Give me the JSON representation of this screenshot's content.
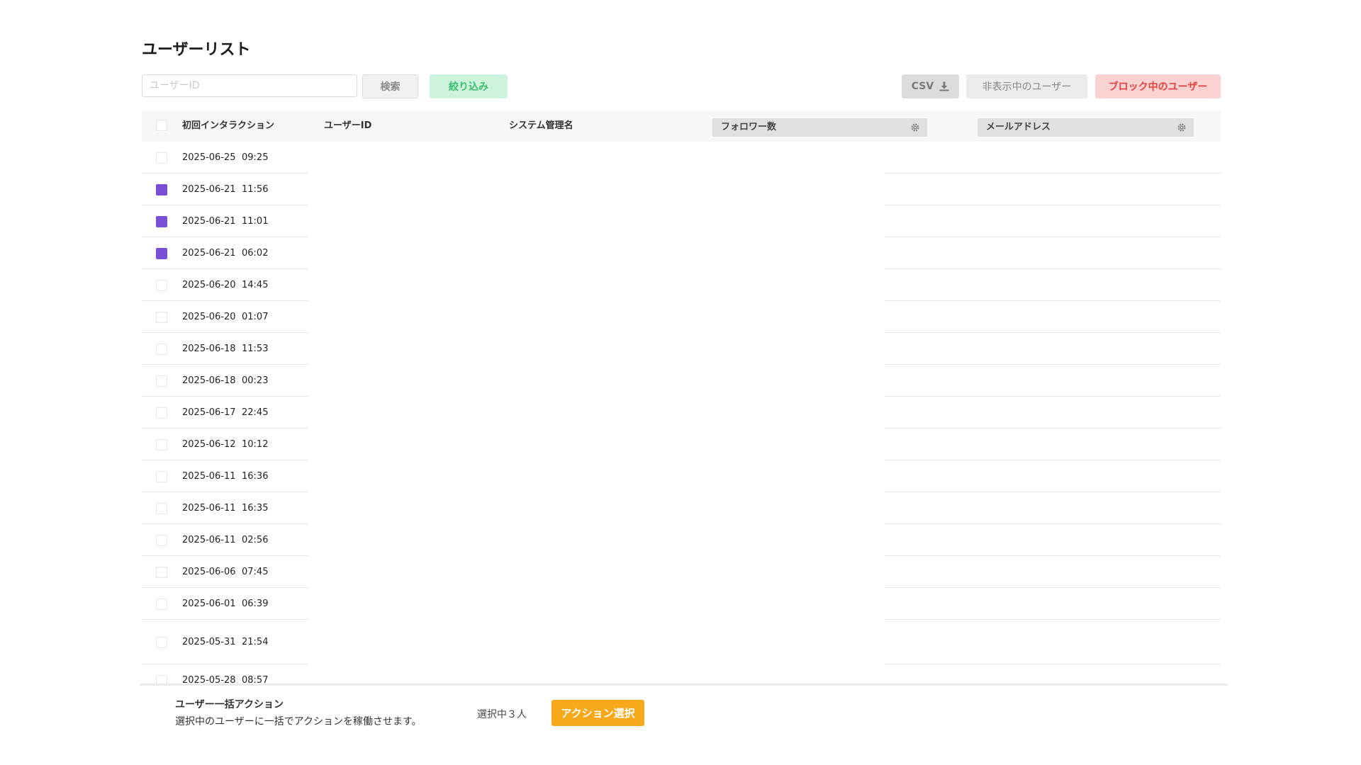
{
  "page": {
    "title": "ユーザーリスト"
  },
  "toolbar": {
    "search_placeholder": "ユーザーID",
    "search_value": "",
    "search_label": "検索",
    "filter_label": "絞り込み",
    "csv_label": "CSV",
    "hidden_users_label": "非表示中のユーザー",
    "blocked_users_label": "ブロック中のユーザー"
  },
  "table": {
    "headers": {
      "first_interaction": "初回インタラクション",
      "user_id": "ユーザーID",
      "system_name": "システム管理名",
      "followers": "フォロワー数",
      "email": "メールアドレス"
    },
    "rows": [
      {
        "date": "2025-06-25",
        "time": "09:25",
        "checked": false
      },
      {
        "date": "2025-06-21",
        "time": "11:56",
        "checked": true
      },
      {
        "date": "2025-06-21",
        "time": "11:01",
        "checked": true
      },
      {
        "date": "2025-06-21",
        "time": "06:02",
        "checked": true
      },
      {
        "date": "2025-06-20",
        "time": "14:45",
        "checked": false
      },
      {
        "date": "2025-06-20",
        "time": "01:07",
        "checked": false
      },
      {
        "date": "2025-06-18",
        "time": "11:53",
        "checked": false
      },
      {
        "date": "2025-06-18",
        "time": "00:23",
        "checked": false
      },
      {
        "date": "2025-06-17",
        "time": "22:45",
        "checked": false
      },
      {
        "date": "2025-06-12",
        "time": "10:12",
        "checked": false
      },
      {
        "date": "2025-06-11",
        "time": "16:36",
        "checked": false
      },
      {
        "date": "2025-06-11",
        "time": "16:35",
        "checked": false
      },
      {
        "date": "2025-06-11",
        "time": "02:56",
        "checked": false
      },
      {
        "date": "2025-06-06",
        "time": "07:45",
        "checked": false
      },
      {
        "date": "2025-06-01",
        "time": "06:39",
        "checked": false
      },
      {
        "date": "2025-05-31",
        "time": "21:54",
        "checked": false
      },
      {
        "date": "2025-05-28",
        "time": "08:57",
        "checked": false
      }
    ]
  },
  "bulk": {
    "title": "ユーザー一括アクション",
    "description": "選択中のユーザーに一括でアクションを稼働させます。",
    "selected_count": "選択中３人",
    "action_label": "アクション選択"
  },
  "colors": {
    "checked": "#7a4fd8",
    "filter_bg": "#cdf3dc",
    "filter_text": "#3bbf6e",
    "blocked_bg": "#fbd2d2",
    "blocked_text": "#e0413f",
    "action_bg": "#f7a81b"
  },
  "icons": {
    "csv": "download-icon",
    "column_settings": "gear-icon"
  }
}
